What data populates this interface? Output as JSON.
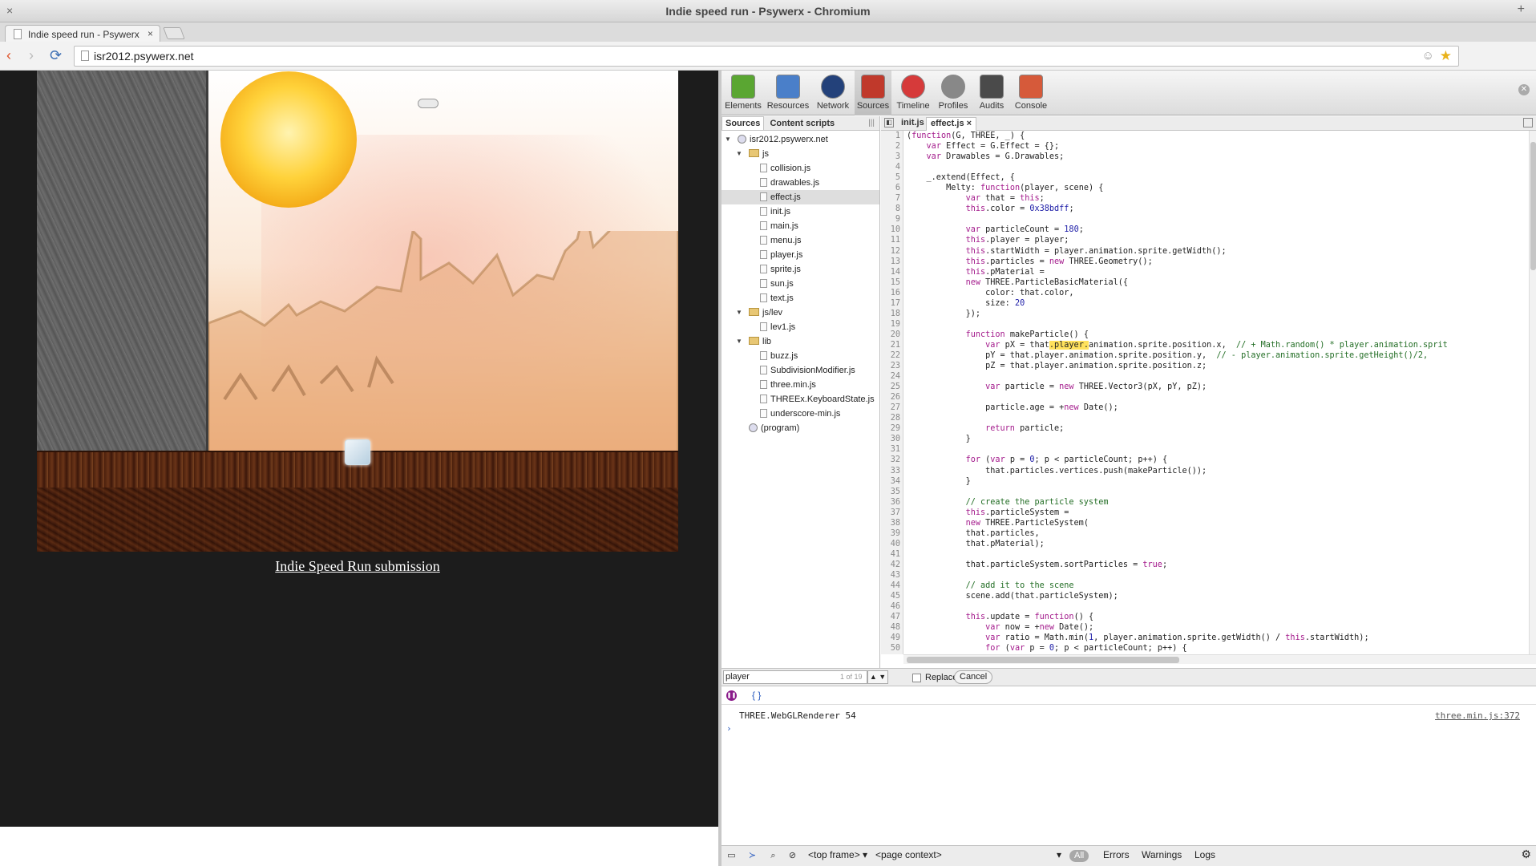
{
  "window": {
    "title": "Indie speed run - Psywerx - Chromium",
    "close_glyph": "×",
    "plus_glyph": "+"
  },
  "tab": {
    "title": "Indie speed run - Psywerx",
    "close": "×"
  },
  "url": "isr2012.psywerx.net",
  "nav_icons": {
    "back": "‹",
    "forward": "›",
    "reload": "⟳",
    "menu": "☰",
    "dropdown": "▼"
  },
  "page": {
    "link_text": "Indie Speed Run submission"
  },
  "devtools": {
    "toolbar": [
      {
        "label": "Elements",
        "icon": "elements-icon",
        "color": "#5aa632"
      },
      {
        "label": "Resources",
        "icon": "resources-icon",
        "color": "#4a7fc9"
      },
      {
        "label": "Network",
        "icon": "network-icon",
        "color": "#23417a"
      },
      {
        "label": "Sources",
        "icon": "sources-icon",
        "color": "#c0392b"
      },
      {
        "label": "Timeline",
        "icon": "timeline-icon",
        "color": "#d63a3a"
      },
      {
        "label": "Profiles",
        "icon": "profiles-icon",
        "color": "#888888"
      },
      {
        "label": "Audits",
        "icon": "audits-icon",
        "color": "#4a4a4a"
      },
      {
        "label": "Console",
        "icon": "console-icon",
        "color": "#d65a3a"
      }
    ],
    "nav_tabs": [
      "Sources",
      "Content scripts"
    ],
    "tree": [
      {
        "label": "isr2012.psywerx.net",
        "kind": "globe",
        "indent": 0,
        "expanded": true
      },
      {
        "label": "js",
        "kind": "folder",
        "indent": 1,
        "expanded": true
      },
      {
        "label": "collision.js",
        "kind": "file",
        "indent": 2
      },
      {
        "label": "drawables.js",
        "kind": "file",
        "indent": 2
      },
      {
        "label": "effect.js",
        "kind": "file",
        "indent": 2,
        "selected": true
      },
      {
        "label": "init.js",
        "kind": "file",
        "indent": 2
      },
      {
        "label": "main.js",
        "kind": "file",
        "indent": 2
      },
      {
        "label": "menu.js",
        "kind": "file",
        "indent": 2
      },
      {
        "label": "player.js",
        "kind": "file",
        "indent": 2
      },
      {
        "label": "sprite.js",
        "kind": "file",
        "indent": 2
      },
      {
        "label": "sun.js",
        "kind": "file",
        "indent": 2
      },
      {
        "label": "text.js",
        "kind": "file",
        "indent": 2
      },
      {
        "label": "js/lev",
        "kind": "folder",
        "indent": 1,
        "expanded": true
      },
      {
        "label": "lev1.js",
        "kind": "file",
        "indent": 2
      },
      {
        "label": "lib",
        "kind": "folder",
        "indent": 1,
        "expanded": true
      },
      {
        "label": "buzz.js",
        "kind": "file",
        "indent": 2
      },
      {
        "label": "SubdivisionModifier.js",
        "kind": "file",
        "indent": 2
      },
      {
        "label": "three.min.js",
        "kind": "file",
        "indent": 2
      },
      {
        "label": "THREEx.KeyboardState.js",
        "kind": "file",
        "indent": 2
      },
      {
        "label": "underscore-min.js",
        "kind": "file",
        "indent": 2
      },
      {
        "label": "(program)",
        "kind": "program",
        "indent": 1
      }
    ],
    "editor_tabs": [
      "init.js",
      "effect.js"
    ],
    "active_tab_close": "×",
    "code_lines": [
      "(function(G, THREE, _) {",
      "    var Effect = G.Effect = {};",
      "    var Drawables = G.Drawables;",
      "",
      "    _.extend(Effect, {",
      "        Melty: function(player, scene) {",
      "            var that = this;",
      "            this.color = 0x38bdff;",
      "",
      "            var particleCount = 180;",
      "            this.player = player;",
      "            this.startWidth = player.animation.sprite.getWidth();",
      "            this.particles = new THREE.Geometry();",
      "            this.pMaterial =",
      "            new THREE.ParticleBasicMaterial({",
      "                color: that.color,",
      "                size: 20",
      "            });",
      "",
      "            function makeParticle() {",
      "                var pX = that.player.animation.sprite.position.x,  // + Math.random() * player.animation.sprit",
      "                pY = that.player.animation.sprite.position.y,  // - player.animation.sprite.getHeight()/2,",
      "                pZ = that.player.animation.sprite.position.z;",
      "",
      "                var particle = new THREE.Vector3(pX, pY, pZ);",
      "",
      "                particle.age = +new Date();",
      "",
      "                return particle;",
      "            }",
      "",
      "            for (var p = 0; p < particleCount; p++) {",
      "                that.particles.vertices.push(makeParticle());",
      "            }",
      "",
      "            // create the particle system",
      "            this.particleSystem =",
      "            new THREE.ParticleSystem(",
      "            that.particles,",
      "            that.pMaterial);",
      "",
      "            that.particleSystem.sortParticles = true;",
      "",
      "            // add it to the scene",
      "            scene.add(that.particleSystem);",
      "",
      "            this.update = function() {",
      "                var now = +new Date();",
      "                var ratio = Math.min(1, player.animation.sprite.getWidth() / this.startWidth);",
      "                for (var p = 0; p < particleCount; p++) {",
      ""
    ],
    "find": {
      "query": "player",
      "count": "1 of 19",
      "replace_label": "Replace",
      "cancel_label": "Cancel",
      "arrows": "▲ ▼"
    },
    "console": {
      "message": "THREE.WebGLRenderer 54",
      "source": "three.min.js:372",
      "prompt": "›",
      "pause_glyph": "❚❚",
      "pretty_glyph": "{ }"
    },
    "statusbar": {
      "frame": "<top frame>",
      "context": "<page context>",
      "filters": [
        "All",
        "Errors",
        "Warnings",
        "Logs"
      ],
      "gear": "⚙"
    }
  }
}
